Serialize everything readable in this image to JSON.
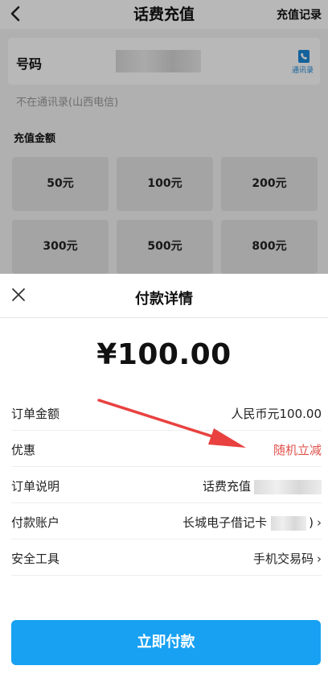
{
  "header": {
    "title": "话费充值",
    "right_link": "充值记录"
  },
  "phone": {
    "label": "号码",
    "contacts_label": "通讯录",
    "note": "不在通讯录(山西电信)"
  },
  "recharge": {
    "section_title": "充值金额",
    "amounts": [
      "50元",
      "100元",
      "200元",
      "300元",
      "500元",
      "800元"
    ]
  },
  "sheet": {
    "title": "付款详情",
    "amount": "¥100.00",
    "rows": [
      {
        "label": "订单金额",
        "value": "人民币元100.00"
      },
      {
        "label": "优惠",
        "value": "随机立减"
      },
      {
        "label": "订单说明",
        "value": "话费充值"
      },
      {
        "label": "付款账户",
        "value": "长城电子借记卡",
        "suffix": ")"
      },
      {
        "label": "安全工具",
        "value": "手机交易码"
      }
    ],
    "pay_button": "立即付款"
  },
  "colors": {
    "primary": "#18a1f2",
    "discount": "#e0524c",
    "annotation_arrow": "#e8413f",
    "contacts_icon": "#1b88d9"
  },
  "icons": [
    "back-arrow-icon",
    "contacts-book-icon",
    "close-icon",
    "chevron-right-icon"
  ]
}
